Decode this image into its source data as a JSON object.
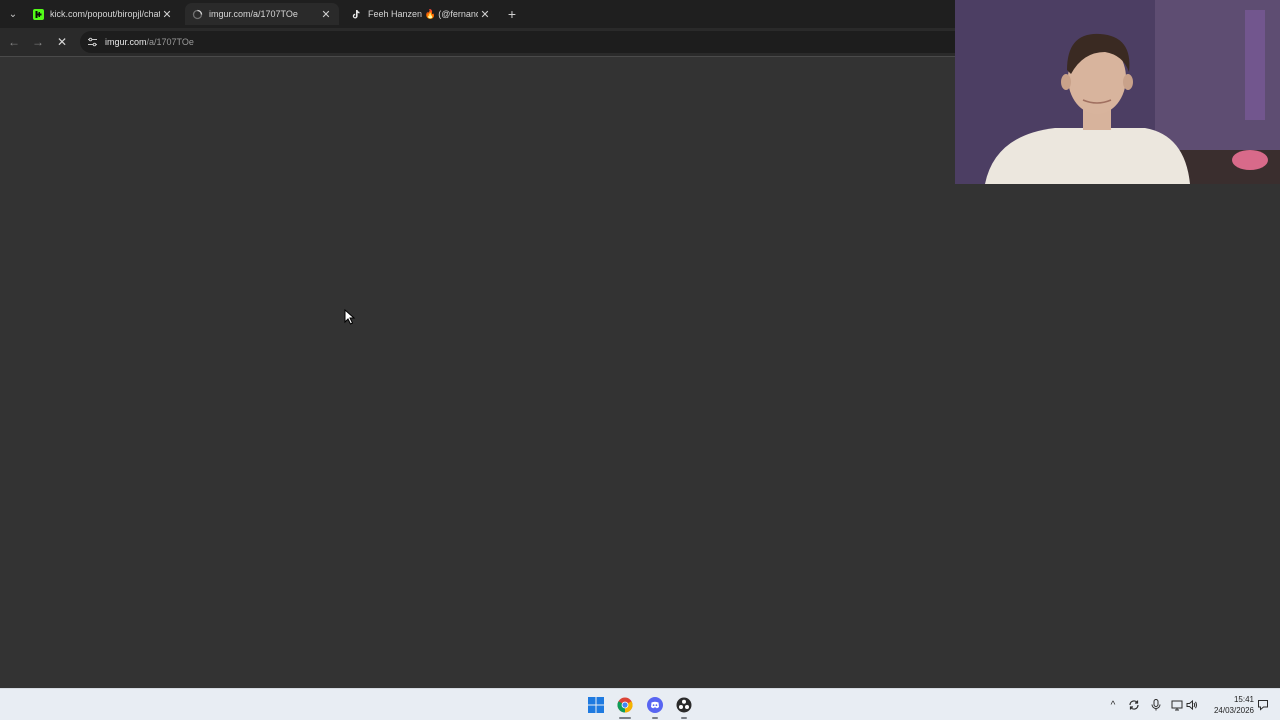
{
  "browser": {
    "tabs": [
      {
        "title": "kick.com/popout/biropjl/chat",
        "favicon": "kick-icon",
        "active": false
      },
      {
        "title": "imgur.com/a/1707TOe",
        "favicon": "loading-spinner-icon",
        "active": true
      },
      {
        "title": "Feeh Hanzen 🔥 (@fernandaha",
        "favicon": "tiktok-icon",
        "active": false
      }
    ],
    "tab_close_glyph": "✕",
    "new_tab_glyph": "+",
    "tab_menu_glyph": "⌄",
    "toolbar": {
      "back_glyph": "←",
      "forward_glyph": "→",
      "stop_glyph": "✕"
    },
    "address": {
      "host": "imgur.com",
      "path": "/a/1707TOe"
    }
  },
  "taskbar": {
    "apps": [
      {
        "name": "start-icon"
      },
      {
        "name": "chrome-icon",
        "running": true
      },
      {
        "name": "discord-icon",
        "running": true
      },
      {
        "name": "obs-icon",
        "running": true
      }
    ],
    "tray": {
      "overflow_glyph": "^"
    },
    "clock": {
      "time": "15:41",
      "date": "24/03/2026"
    }
  },
  "colors": {
    "page_bg": "#333333",
    "tabstrip_bg": "#1f1f1f",
    "active_tab_bg": "#2a2a2a",
    "taskbar_bg": "#e8edf3",
    "kick_green": "#53fc18"
  }
}
